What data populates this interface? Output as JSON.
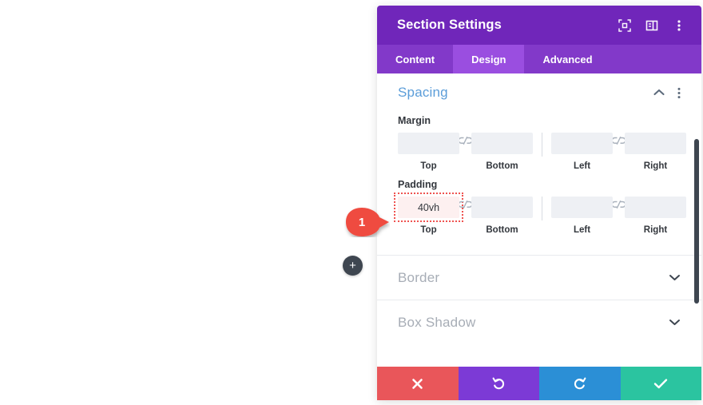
{
  "panel": {
    "title": "Section Settings",
    "header_icons": [
      {
        "name": "expand-icon",
        "label": "Expand"
      },
      {
        "name": "layout-icon",
        "label": "Layout"
      },
      {
        "name": "more-options-icon",
        "label": "More options"
      }
    ],
    "tabs": [
      {
        "label": "Content",
        "active": false
      },
      {
        "label": "Design",
        "active": true
      },
      {
        "label": "Advanced",
        "active": false
      }
    ]
  },
  "spacing": {
    "title": "Spacing",
    "collapse_icon": "chevron-up-icon",
    "more_icon": "more-options-icon",
    "margin": {
      "label": "Margin",
      "fields": [
        {
          "caption": "Top",
          "value": "",
          "highlighted": false
        },
        {
          "caption": "Bottom",
          "value": "",
          "highlighted": false
        },
        {
          "caption": "Left",
          "value": "",
          "highlighted": false
        },
        {
          "caption": "Right",
          "value": "",
          "highlighted": false
        }
      ]
    },
    "padding": {
      "label": "Padding",
      "fields": [
        {
          "caption": "Top",
          "value": "40vh",
          "highlighted": true
        },
        {
          "caption": "Bottom",
          "value": "",
          "highlighted": false
        },
        {
          "caption": "Left",
          "value": "",
          "highlighted": false
        },
        {
          "caption": "Right",
          "value": "",
          "highlighted": false
        }
      ]
    },
    "link_icon": "link-icon"
  },
  "collapsed_sections": [
    {
      "title": "Border",
      "icon": "chevron-down-icon"
    },
    {
      "title": "Box Shadow",
      "icon": "chevron-down-icon"
    }
  ],
  "footer": {
    "buttons": [
      {
        "name": "cancel-button",
        "icon": "close-icon",
        "color": "#e9565a"
      },
      {
        "name": "undo-button",
        "icon": "undo-icon",
        "color": "#7c3ad6"
      },
      {
        "name": "redo-button",
        "icon": "redo-icon",
        "color": "#2b8fd6"
      },
      {
        "name": "save-button",
        "icon": "check-icon",
        "color": "#2bc4a0"
      }
    ]
  },
  "add_button": {
    "icon": "plus-icon",
    "label": "+"
  },
  "callout": {
    "number": "1",
    "color": "#ef4c3f"
  },
  "colors": {
    "header_purple": "#7026ba",
    "tabbar_purple": "#8239c9",
    "active_tab_purple": "#9a4ee0",
    "section_title_blue": "#5b9dd9",
    "input_grey": "#eef0f4",
    "highlight_red": "#ef5350"
  }
}
